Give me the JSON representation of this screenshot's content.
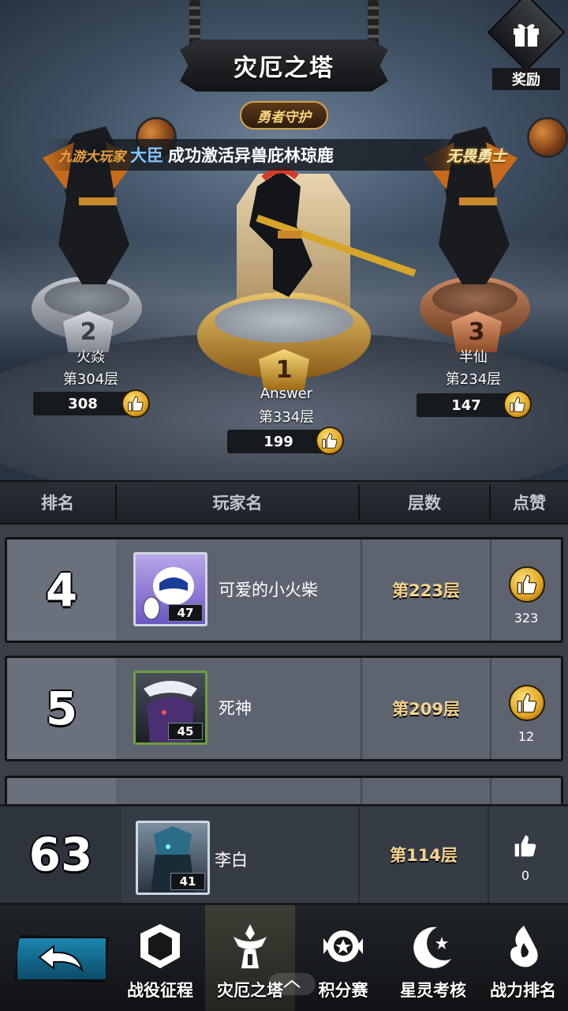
{
  "header": {
    "title": "灾厄之塔",
    "reward_label": "奖励",
    "guard_badge": "勇者守护"
  },
  "notice": {
    "part1": "九游大玩家",
    "part2": "大臣",
    "part3": "成功激活异兽庇林琼鹿"
  },
  "title_tag": "无畏勇士",
  "podium": [
    {
      "rank": "1",
      "name": "Answer",
      "floor": "第334层",
      "likes": "199"
    },
    {
      "rank": "2",
      "name": "火焱",
      "floor": "第304层",
      "likes": "308"
    },
    {
      "rank": "3",
      "name": "半仙",
      "floor": "第234层",
      "likes": "147"
    }
  ],
  "table": {
    "headers": [
      "排名",
      "玩家名",
      "层数",
      "点赞"
    ]
  },
  "rows": [
    {
      "rank": "4",
      "name": "可爱的小火柴",
      "level": "47",
      "floor": "第223层",
      "likes": "323"
    },
    {
      "rank": "5",
      "name": "死神",
      "level": "45",
      "floor": "第209层",
      "likes": "12"
    }
  ],
  "my_row": {
    "rank": "63",
    "name": "李白",
    "level": "41",
    "floor": "第114层",
    "likes": "0"
  },
  "nav": {
    "items": [
      {
        "label": "战役征程",
        "icon": "campaign-icon"
      },
      {
        "label": "灾厄之塔",
        "icon": "tower-icon"
      },
      {
        "label": "积分赛",
        "icon": "points-icon"
      },
      {
        "label": "星灵考核",
        "icon": "moon-star-icon"
      },
      {
        "label": "战力排名",
        "icon": "power-icon"
      }
    ],
    "active": "灾厄之塔"
  },
  "colors": {
    "floor_text": "#f3d38e",
    "like_gold": "#e0a421",
    "back_button": "#1c87b0"
  }
}
